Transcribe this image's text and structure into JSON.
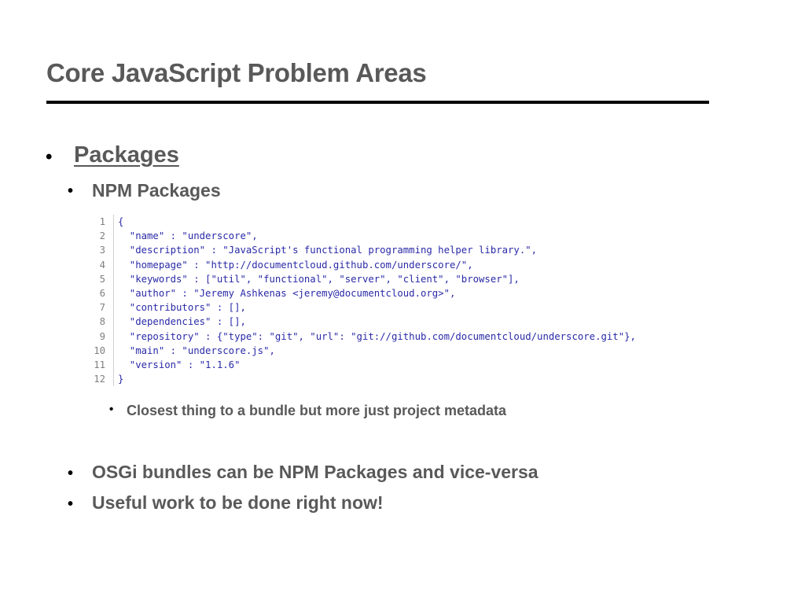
{
  "slide": {
    "title": "Core JavaScript Problem Areas",
    "bullet_char": "•",
    "level1": {
      "label": "Packages"
    },
    "level2": [
      {
        "label": "NPM Packages"
      },
      {
        "label": "OSGi bundles can be NPM Packages and vice-versa"
      },
      {
        "label": "Useful work to be done right now!"
      }
    ],
    "level3": {
      "label": "Closest thing to a bundle but more just project metadata"
    },
    "code": {
      "lines": [
        {
          "num": "1",
          "text": "{"
        },
        {
          "num": "2",
          "text": "  \"name\" : \"underscore\","
        },
        {
          "num": "3",
          "text": "  \"description\" : \"JavaScript's functional programming helper library.\","
        },
        {
          "num": "4",
          "text": "  \"homepage\" : \"http://documentcloud.github.com/underscore/\","
        },
        {
          "num": "5",
          "text": "  \"keywords\" : [\"util\", \"functional\", \"server\", \"client\", \"browser\"],"
        },
        {
          "num": "6",
          "text": "  \"author\" : \"Jeremy Ashkenas <jeremy@documentcloud.org>\","
        },
        {
          "num": "7",
          "text": "  \"contributors\" : [],"
        },
        {
          "num": "8",
          "text": "  \"dependencies\" : [],"
        },
        {
          "num": "9",
          "text": "  \"repository\" : {\"type\": \"git\", \"url\": \"git://github.com/documentcloud/underscore.git\"},"
        },
        {
          "num": "10",
          "text": "  \"main\" : \"underscore.js\","
        },
        {
          "num": "11",
          "text": "  \"version\" : \"1.1.6\""
        },
        {
          "num": "12",
          "text": "}"
        }
      ]
    }
  }
}
